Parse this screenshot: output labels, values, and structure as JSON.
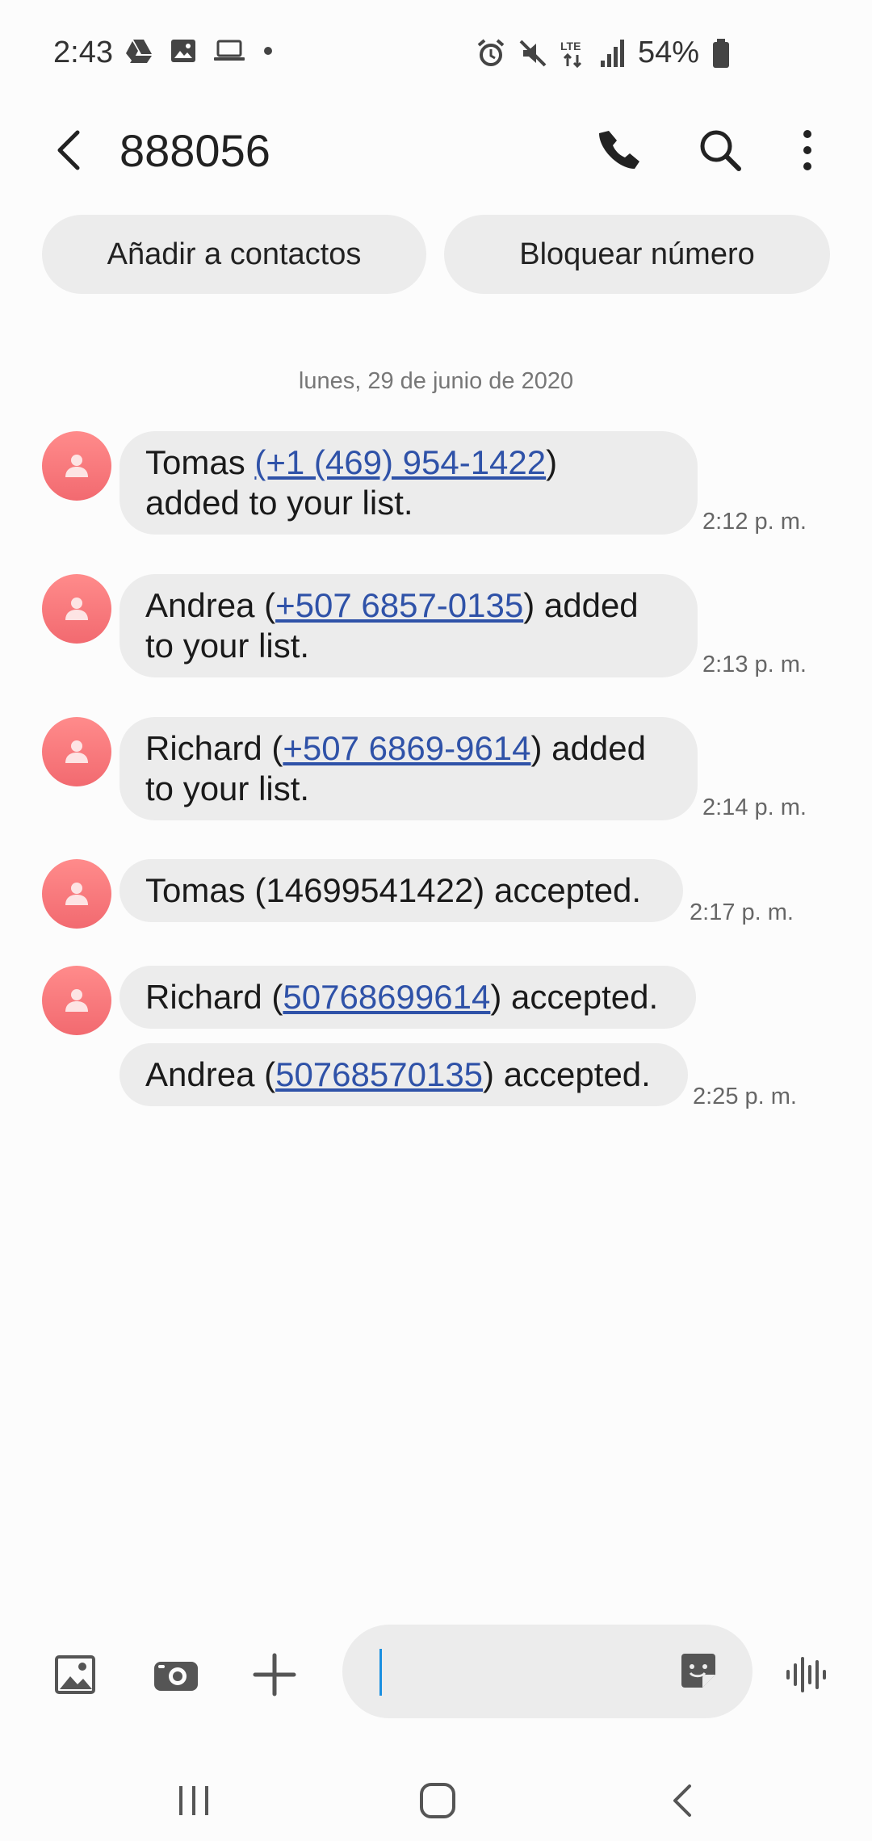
{
  "status": {
    "time": "2:43",
    "battery": "54%",
    "left_icons": [
      "drive-icon",
      "image-icon",
      "laptop-icon",
      "dot-icon"
    ],
    "right_icons": [
      "alarm-icon",
      "mute-icon",
      "lte-icon",
      "signal-icon",
      "battery-icon"
    ]
  },
  "header": {
    "title": "888056"
  },
  "actions": {
    "add_contact": "Añadir a contactos",
    "block_number": "Bloquear número"
  },
  "date_separator": "lunes, 29 de junio de 2020",
  "messages": [
    {
      "line1_pre": "Tomas ",
      "line1_link": "(+1 (469) 954-1422",
      "line1_post": ")",
      "line2": "added to your list.",
      "time": "2:12 p. m."
    },
    {
      "line1_pre": "Andrea (",
      "line1_link": "+507 6857-0135",
      "line1_post": ") added",
      "line2": "to your list.",
      "time": "2:13 p. m."
    },
    {
      "line1_pre": "Richard (",
      "line1_link": "+507 6869-9614",
      "line1_post": ") added",
      "line2": "to your list.",
      "time": "2:14 p. m."
    },
    {
      "text": "Tomas (14699541422) accepted.",
      "time": "2:17 p. m."
    },
    {
      "pre": "Richard (",
      "link": "50768699614",
      "post": ") accepted."
    },
    {
      "pre": "Andrea (",
      "link": "50768570135",
      "post": ") accepted.",
      "time": "2:25 p. m."
    }
  ],
  "composer": {
    "placeholder": ""
  },
  "colors": {
    "avatar": "#f26a70",
    "link": "#2f52a8",
    "bubble": "#ececec",
    "caret": "#1a8fe0"
  }
}
